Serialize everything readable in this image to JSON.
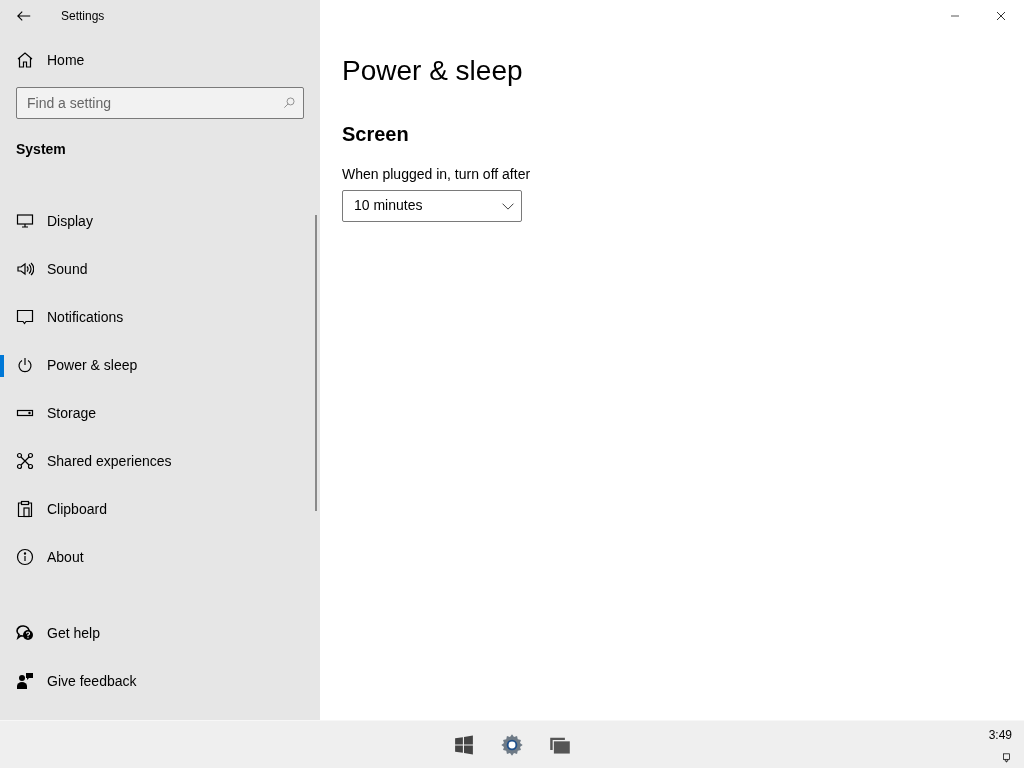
{
  "window": {
    "title": "Settings"
  },
  "sidebar": {
    "home": "Home",
    "search": {
      "placeholder": "Find a setting"
    },
    "section": "System",
    "items": [
      {
        "label": "Display",
        "selected": false
      },
      {
        "label": "Sound",
        "selected": false
      },
      {
        "label": "Notifications",
        "selected": false
      },
      {
        "label": "Power & sleep",
        "selected": true
      },
      {
        "label": "Storage",
        "selected": false
      },
      {
        "label": "Shared experiences",
        "selected": false
      },
      {
        "label": "Clipboard",
        "selected": false
      },
      {
        "label": "About",
        "selected": false
      }
    ],
    "footer_links": [
      "Get help",
      "Give feedback"
    ]
  },
  "main": {
    "title": "Power & sleep",
    "section": "Screen",
    "setting_label": "When plugged in, turn off after",
    "dropdown_value": "10 minutes"
  },
  "taskbar": {
    "clock": "3:49"
  }
}
